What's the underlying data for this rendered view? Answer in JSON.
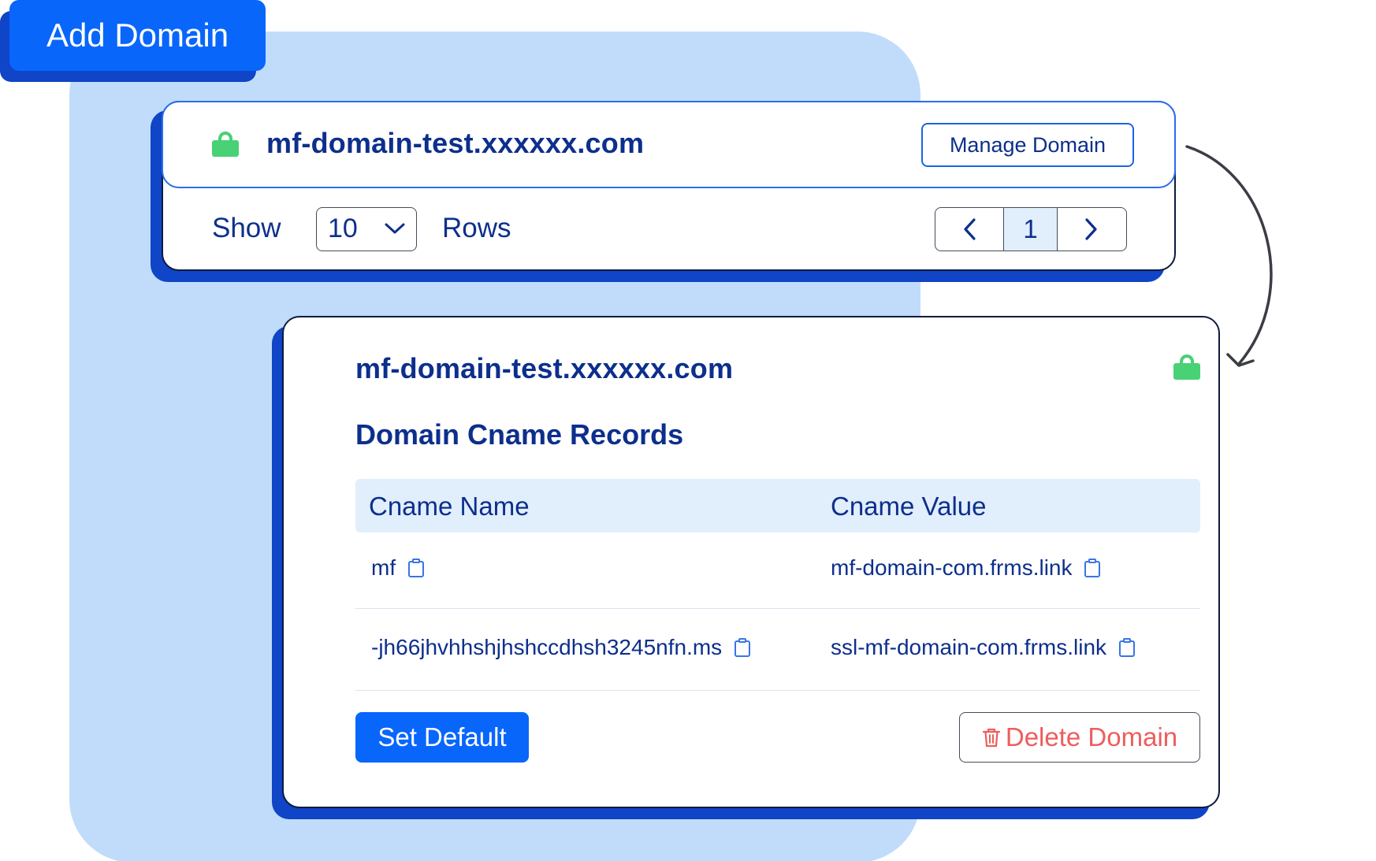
{
  "header": {
    "add_domain_label": "Add Domain"
  },
  "domain_list": {
    "domain": "mf-domain-test.xxxxxx.com",
    "manage_label": "Manage Domain",
    "show_label": "Show",
    "rows_select_value": "10",
    "rows_label": "Rows",
    "current_page": "1"
  },
  "domain_detail": {
    "domain": "mf-domain-test.xxxxxx.com",
    "section_title": "Domain Cname Records",
    "columns": [
      "Cname Name",
      "Cname Value"
    ],
    "records": [
      {
        "name": "mf",
        "value": "mf-domain-com.frms.link"
      },
      {
        "name": "-jh66jhvhhshjhshccdhsh3245nfn.ms",
        "value": "ssl-mf-domain-com.frms.link"
      }
    ],
    "set_default_label": "Set Default",
    "delete_label": "Delete Domain"
  },
  "colors": {
    "primary": "#0866fb",
    "primary_shadow": "#0f45c6",
    "background_panel": "#c0dcfa",
    "text": "#0d2f8c",
    "lock": "#48d175",
    "danger": "#ee5d5d"
  },
  "icons": [
    "lock-icon",
    "chevron-down-icon",
    "chevron-left-icon",
    "chevron-right-icon",
    "copy-icon",
    "trash-icon",
    "curved-arrow-icon"
  ]
}
